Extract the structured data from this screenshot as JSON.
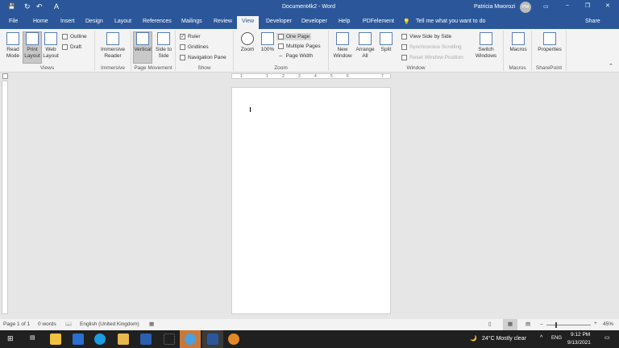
{
  "title": {
    "doc": "Document4k2 - Word",
    "user": "Patricia Mworozi",
    "initials": "PM"
  },
  "qat": {
    "save": "💾",
    "redo": "↻",
    "undo": "↶",
    "font": "A"
  },
  "tabs": [
    "File",
    "Home",
    "Insert",
    "Design",
    "Layout",
    "References",
    "Mailings",
    "Review",
    "View",
    "Developer",
    "Developer",
    "Help",
    "PDFelement"
  ],
  "tell_me": "Tell me what you want to do",
  "share": "Share",
  "ribbon": {
    "views": {
      "label": "Views",
      "read": "Read Mode",
      "print": "Print Layout",
      "web": "Web Layout",
      "outline": "Outline",
      "draft": "Draft"
    },
    "immersive": {
      "label": "Immersive",
      "reader": "Immersive Reader"
    },
    "movement": {
      "label": "Page Movement",
      "vertical": "Vertical",
      "side": "Side to Side"
    },
    "show": {
      "label": "Show",
      "ruler": "Ruler",
      "gridlines": "Gridlines",
      "nav": "Navigation Pane"
    },
    "zoom": {
      "label": "Zoom",
      "zoom": "Zoom",
      "pct": "100%",
      "one": "One Page",
      "multi": "Multiple Pages",
      "width": "Page Width"
    },
    "window": {
      "label": "Window",
      "new": "New Window",
      "arrange": "Arrange All",
      "split": "Split",
      "side": "View Side by Side",
      "sync": "Synchronous Scrolling",
      "reset": "Reset Window Position",
      "switch": "Switch Windows"
    },
    "macros": {
      "label": "Macros",
      "macros": "Macros"
    },
    "sharepoint": {
      "label": "SharePoint",
      "props": "Properties"
    }
  },
  "ruler_ticks": [
    "1",
    "1",
    "2",
    "3",
    "4",
    "5",
    "6",
    "7"
  ],
  "status": {
    "page": "Page 1 of 1",
    "words": "0 words",
    "lang": "English (United Kingdom)",
    "zoom": "45%"
  },
  "taskbar": {
    "weather": "24°C  Mostly clear",
    "lang": "ENG",
    "time": "9:12 PM",
    "date": "9/13/2021"
  }
}
